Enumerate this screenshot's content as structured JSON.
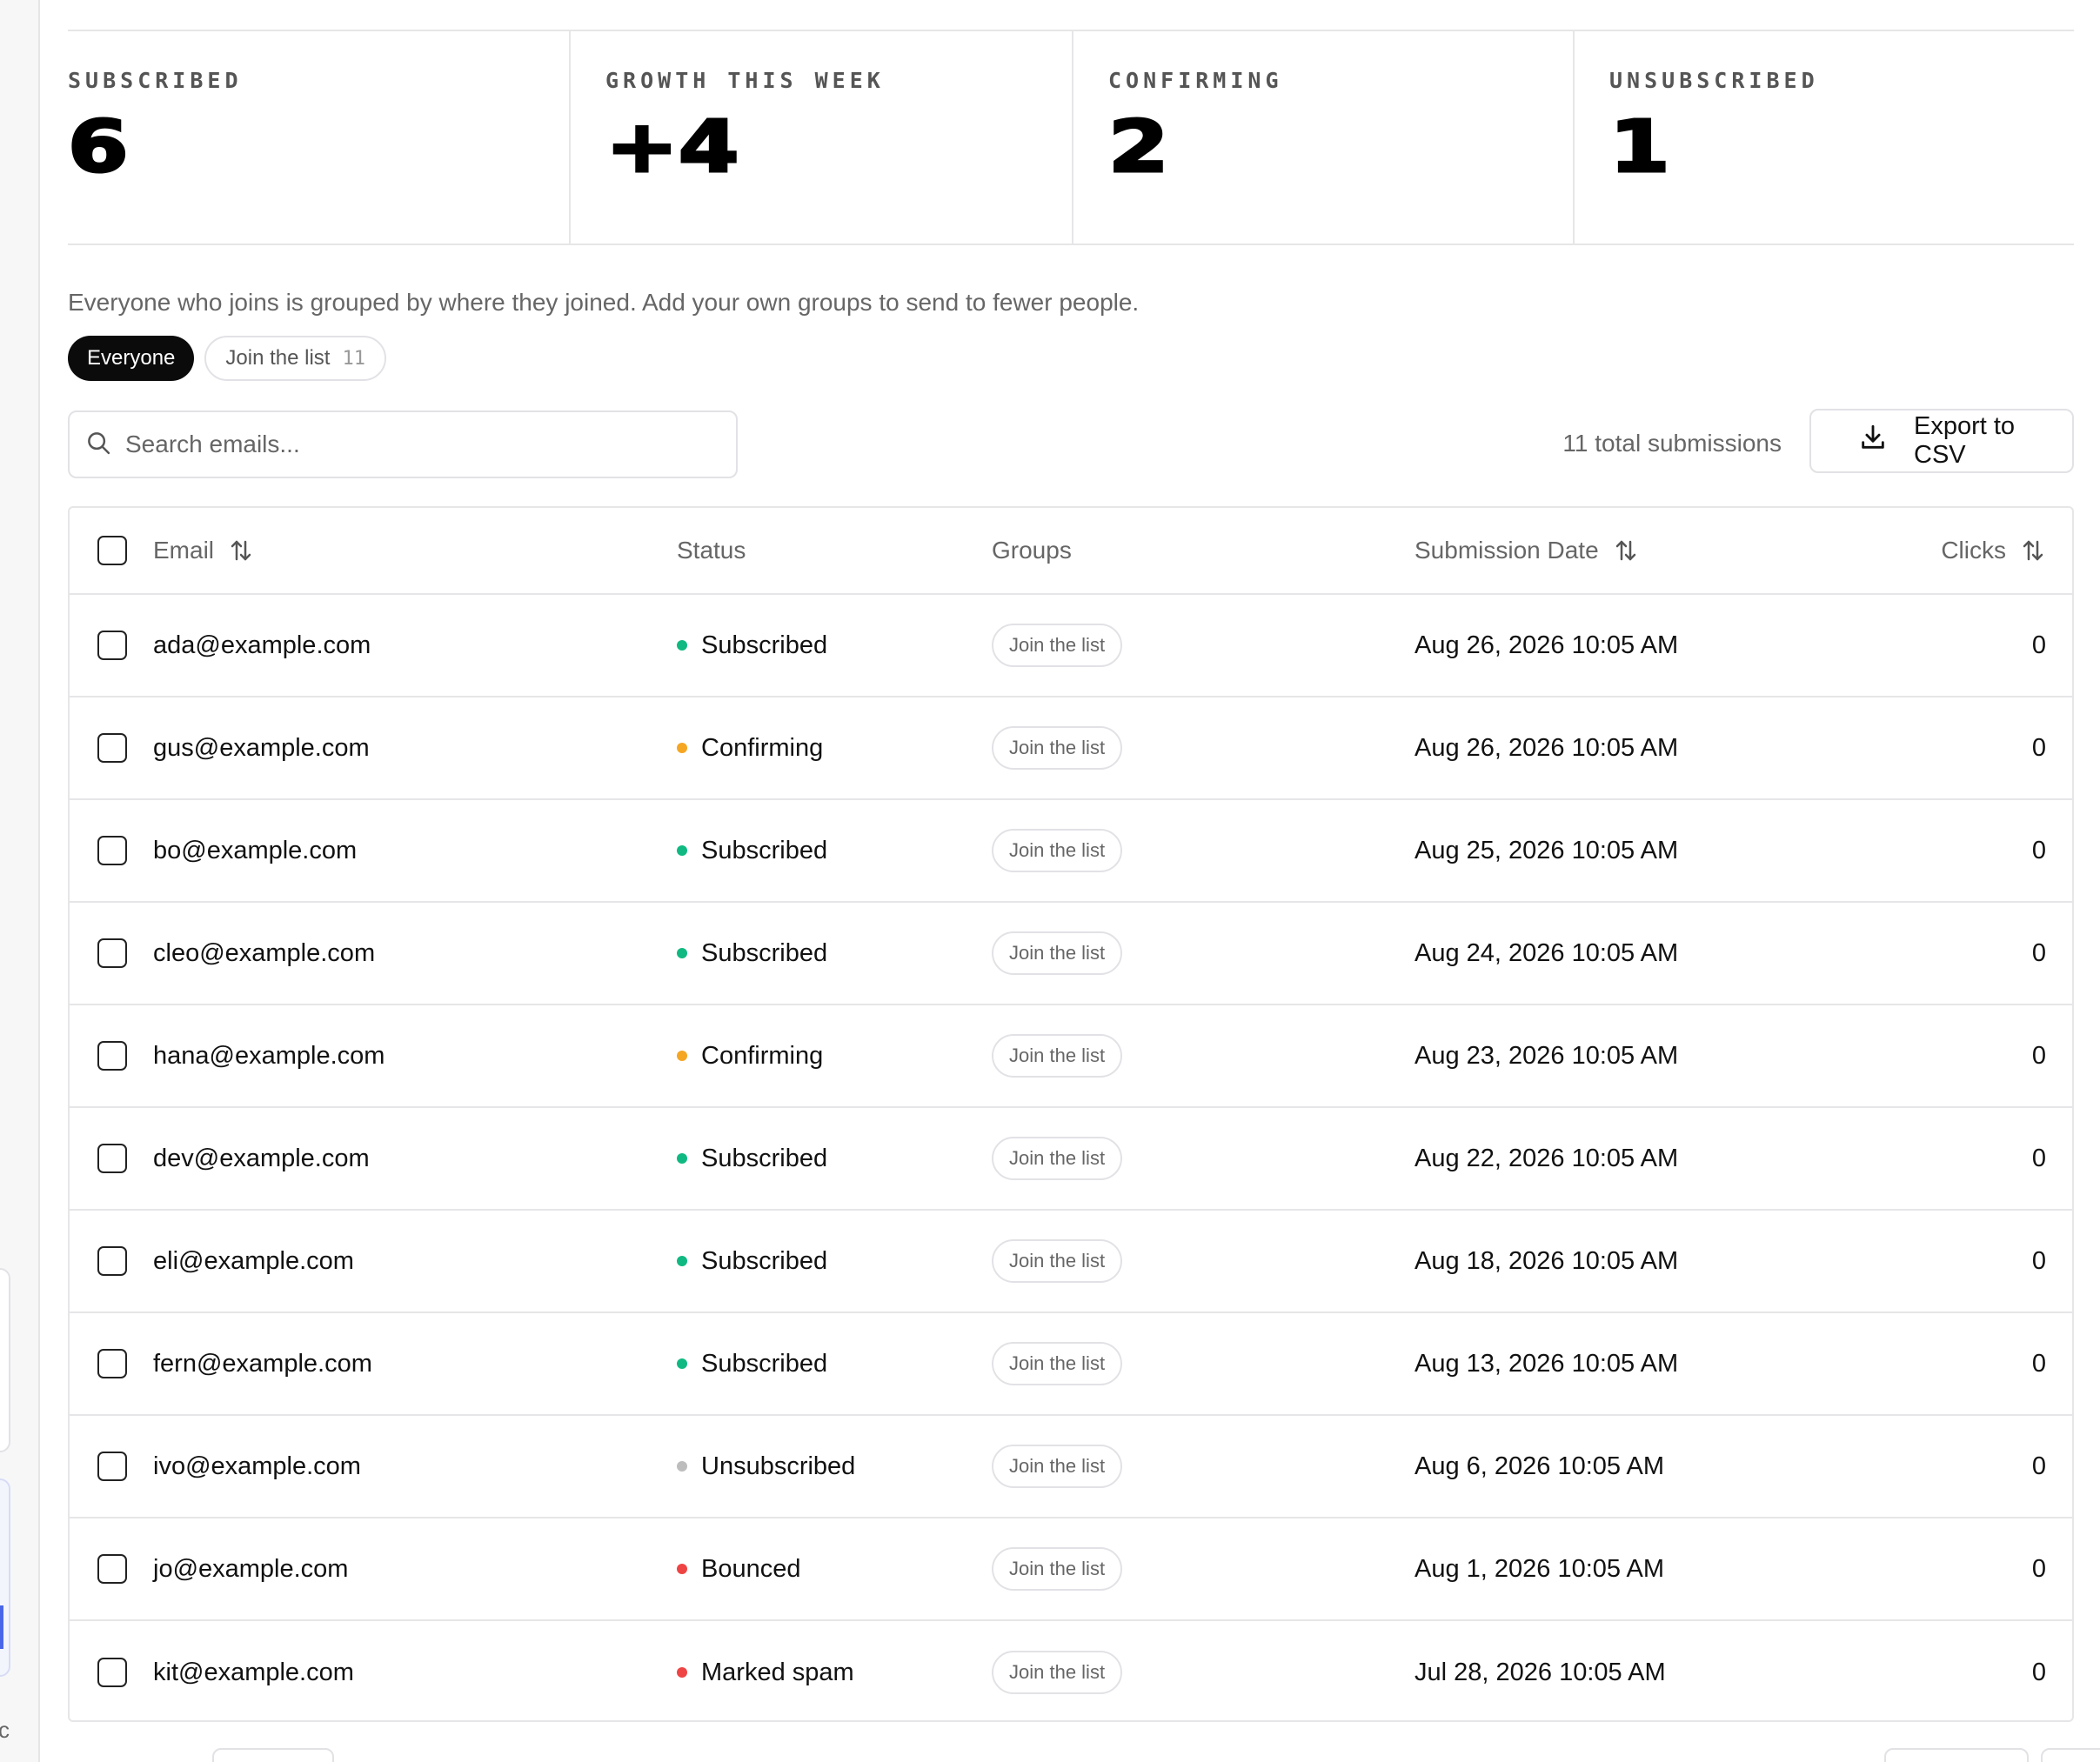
{
  "stats": [
    {
      "label": "SUBSCRIBED",
      "value": "6"
    },
    {
      "label": "GROWTH THIS WEEK",
      "value": "+4"
    },
    {
      "label": "CONFIRMING",
      "value": "2"
    },
    {
      "label": "UNSUBSCRIBED",
      "value": "1"
    }
  ],
  "description": "Everyone who joins is grouped by where they joined. Add your own groups to send to fewer people.",
  "group_filters": {
    "everyone_label": "Everyone",
    "join_list_label": "Join the list",
    "join_list_count": "11"
  },
  "search": {
    "placeholder": "Search emails..."
  },
  "total_submissions": "11 total submissions",
  "export_label": "Export to CSV",
  "table": {
    "headers": {
      "email": "Email",
      "status": "Status",
      "groups": "Groups",
      "date": "Submission Date",
      "clicks": "Clicks"
    },
    "rows": [
      {
        "email": "ada@example.com",
        "status": "Subscribed",
        "group": "Join the list",
        "date": "Aug 26, 2026 10:05 AM",
        "clicks": "0"
      },
      {
        "email": "gus@example.com",
        "status": "Confirming",
        "group": "Join the list",
        "date": "Aug 26, 2026 10:05 AM",
        "clicks": "0"
      },
      {
        "email": "bo@example.com",
        "status": "Subscribed",
        "group": "Join the list",
        "date": "Aug 25, 2026 10:05 AM",
        "clicks": "0"
      },
      {
        "email": "cleo@example.com",
        "status": "Subscribed",
        "group": "Join the list",
        "date": "Aug 24, 2026 10:05 AM",
        "clicks": "0"
      },
      {
        "email": "hana@example.com",
        "status": "Confirming",
        "group": "Join the list",
        "date": "Aug 23, 2026 10:05 AM",
        "clicks": "0"
      },
      {
        "email": "dev@example.com",
        "status": "Subscribed",
        "group": "Join the list",
        "date": "Aug 22, 2026 10:05 AM",
        "clicks": "0"
      },
      {
        "email": "eli@example.com",
        "status": "Subscribed",
        "group": "Join the list",
        "date": "Aug 18, 2026 10:05 AM",
        "clicks": "0"
      },
      {
        "email": "fern@example.com",
        "status": "Subscribed",
        "group": "Join the list",
        "date": "Aug 13, 2026 10:05 AM",
        "clicks": "0"
      },
      {
        "email": "ivo@example.com",
        "status": "Unsubscribed",
        "group": "Join the list",
        "date": "Aug 6, 2026 10:05 AM",
        "clicks": "0"
      },
      {
        "email": "jo@example.com",
        "status": "Bounced",
        "group": "Join the list",
        "date": "Aug 1, 2026 10:05 AM",
        "clicks": "0"
      },
      {
        "email": "kit@example.com",
        "status": "Marked spam",
        "group": "Join the list",
        "date": "Jul 28, 2026 10:05 AM",
        "clicks": "0"
      }
    ]
  },
  "status_colors": {
    "Subscribed": "#10b981",
    "Confirming": "#f5a623",
    "Unsubscribed": "#bdbdbd",
    "Bounced": "#ef4444",
    "Marked spam": "#ef4444"
  },
  "icons": {
    "search": "search-icon",
    "export": "download-icon",
    "sort": "sort-arrows-icon"
  }
}
